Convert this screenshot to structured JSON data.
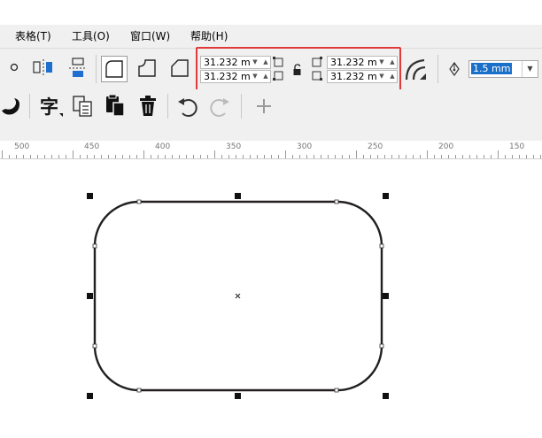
{
  "menu": {
    "items": [
      {
        "label": "表格(T)"
      },
      {
        "label": "工具(O)"
      },
      {
        "label": "窗口(W)"
      },
      {
        "label": "帮助(H)"
      }
    ]
  },
  "corner_radius": {
    "top_left": "31.232 mm",
    "bottom_left": "31.232 mm",
    "top_right": "31.232 mm",
    "bottom_right": "31.232 mm"
  },
  "outline": {
    "width_value": "1.5 mm"
  },
  "ruler": {
    "labels": [
      "500",
      "450",
      "400",
      "350",
      "300",
      "250",
      "200",
      "150"
    ]
  },
  "colors": {
    "highlight_box": "#e23a3a",
    "selection_blue": "#1a6fc9",
    "accent_blue": "#1e6fd0"
  },
  "icons": {
    "undo": "undo-icon",
    "redo": "redo-icon",
    "trash": "trash-icon"
  }
}
